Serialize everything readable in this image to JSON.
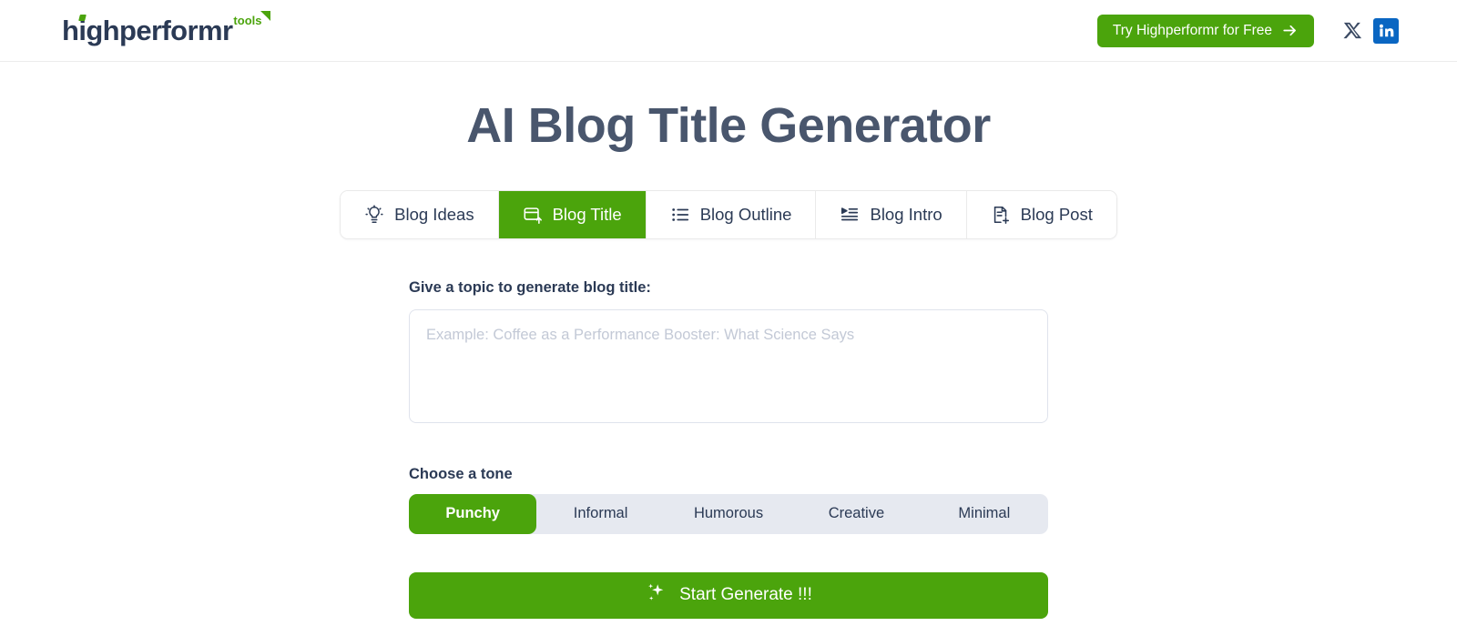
{
  "header": {
    "logo": {
      "word": "highperformr",
      "suffix": "tools",
      "dot_icon": "square-accent-icon",
      "flag_icon": "flag-corner-icon"
    },
    "cta": {
      "label": "Try Highperformr for Free",
      "arrow_icon": "arrow-right-icon",
      "color": "#4ba40c"
    },
    "socials": [
      {
        "name": "x-twitter-icon",
        "label": "X",
        "color": "#2b3a55"
      },
      {
        "name": "linkedin-icon",
        "label": "in",
        "color": "#0a66c2"
      }
    ]
  },
  "main": {
    "title": "AI Blog Title Generator",
    "title_color": "#49566d",
    "tabs": [
      {
        "label": "Blog Ideas",
        "icon": "lightbulb-icon",
        "active": false
      },
      {
        "label": "Blog Title",
        "icon": "card-upload-icon",
        "active": true
      },
      {
        "label": "Blog Outline",
        "icon": "bulleted-list-icon",
        "active": false
      },
      {
        "label": "Blog Intro",
        "icon": "intro-lines-icon",
        "active": false
      },
      {
        "label": "Blog Post",
        "icon": "document-plus-icon",
        "active": false
      }
    ],
    "form": {
      "topic_label": "Give a topic to generate blog title:",
      "topic_value": "",
      "topic_placeholder": "Example: Coffee as a Performance Booster: What Science Says",
      "tone_label": "Choose a tone",
      "tones": [
        {
          "label": "Punchy",
          "active": true
        },
        {
          "label": "Informal",
          "active": false
        },
        {
          "label": "Humorous",
          "active": false
        },
        {
          "label": "Creative",
          "active": false
        },
        {
          "label": "Minimal",
          "active": false
        }
      ],
      "generate_label": "Start Generate !!!",
      "generate_icon": "sparkles-icon",
      "accent_color": "#4ba40c"
    }
  }
}
